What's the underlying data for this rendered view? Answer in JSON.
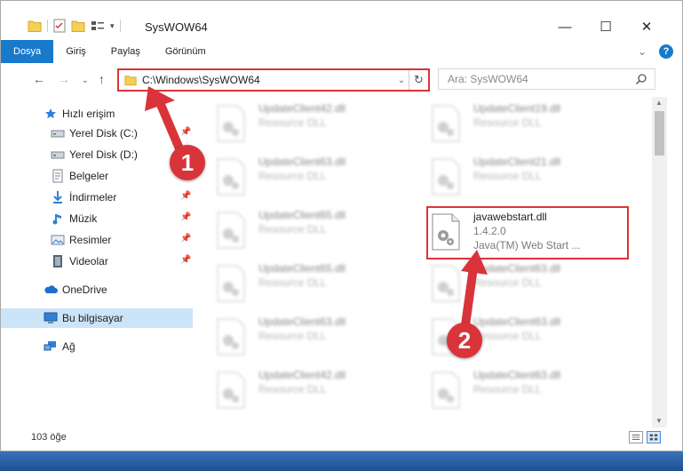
{
  "window": {
    "title": "SysWOW64",
    "controls": {
      "minimize": "—",
      "maximize": "☐",
      "close": "✕"
    }
  },
  "ribbon": {
    "tabs": [
      "Dosya",
      "Giriş",
      "Paylaş",
      "Görünüm"
    ],
    "help_glyph": "?"
  },
  "address": {
    "path": "C:\\Windows\\SysWOW64",
    "search_placeholder": "Ara: SysWOW64"
  },
  "sidebar": {
    "items": [
      {
        "label": "Hızlı erişim",
        "icon": "star-icon",
        "pinned": false
      },
      {
        "label": "Yerel Disk (C:)",
        "icon": "drive-icon",
        "pinned": true
      },
      {
        "label": "Yerel Disk (D:)",
        "icon": "drive-icon",
        "pinned": false
      },
      {
        "label": "Belgeler",
        "icon": "documents-icon",
        "pinned": true
      },
      {
        "label": "İndirmeler",
        "icon": "download-icon",
        "pinned": true
      },
      {
        "label": "Müzik",
        "icon": "music-icon",
        "pinned": true
      },
      {
        "label": "Resimler",
        "icon": "pictures-icon",
        "pinned": true
      },
      {
        "label": "Videolar",
        "icon": "videos-icon",
        "pinned": true
      },
      {
        "label": "OneDrive",
        "icon": "cloud-icon",
        "pinned": false
      },
      {
        "label": "Bu bilgisayar",
        "icon": "computer-icon",
        "pinned": false,
        "selected": true
      },
      {
        "label": "Ağ",
        "icon": "network-icon",
        "pinned": false
      }
    ]
  },
  "files": [
    {
      "name": "UpdateClient42.dll",
      "type": "Resource DLL"
    },
    {
      "name": "UpdateClient19.dll",
      "type": "Resource DLL"
    },
    {
      "name": "UpdateClient63.dll",
      "type": "Resource DLL"
    },
    {
      "name": "UpdateClient21.dll",
      "type": "Resource DLL"
    },
    {
      "name": "UpdateClient65.dll",
      "type": "Resource DLL"
    },
    {
      "name": "javawebstart.dll",
      "version": "1.4.2.0",
      "type": "Java(TM) Web Start ...",
      "highlighted": true
    },
    {
      "name": "UpdateClient65.dll",
      "type": "Resource DLL"
    },
    {
      "name": "UpdateClient63.dll",
      "type": "Resource DLL"
    },
    {
      "name": "UpdateClient63.dll",
      "type": "Resource DLL"
    },
    {
      "name": "UpdateClient63.dll",
      "type": "Resource DLL"
    },
    {
      "name": "UpdateClient42.dll",
      "type": "Resource DLL"
    },
    {
      "name": "UpdateClient63.dll",
      "type": "Resource DLL"
    }
  ],
  "status": {
    "item_count": "103 öğe"
  },
  "callouts": [
    "1",
    "2"
  ],
  "colors": {
    "accent": "#1979ca",
    "highlight": "#d9343a",
    "selected": "#cce4f7"
  }
}
